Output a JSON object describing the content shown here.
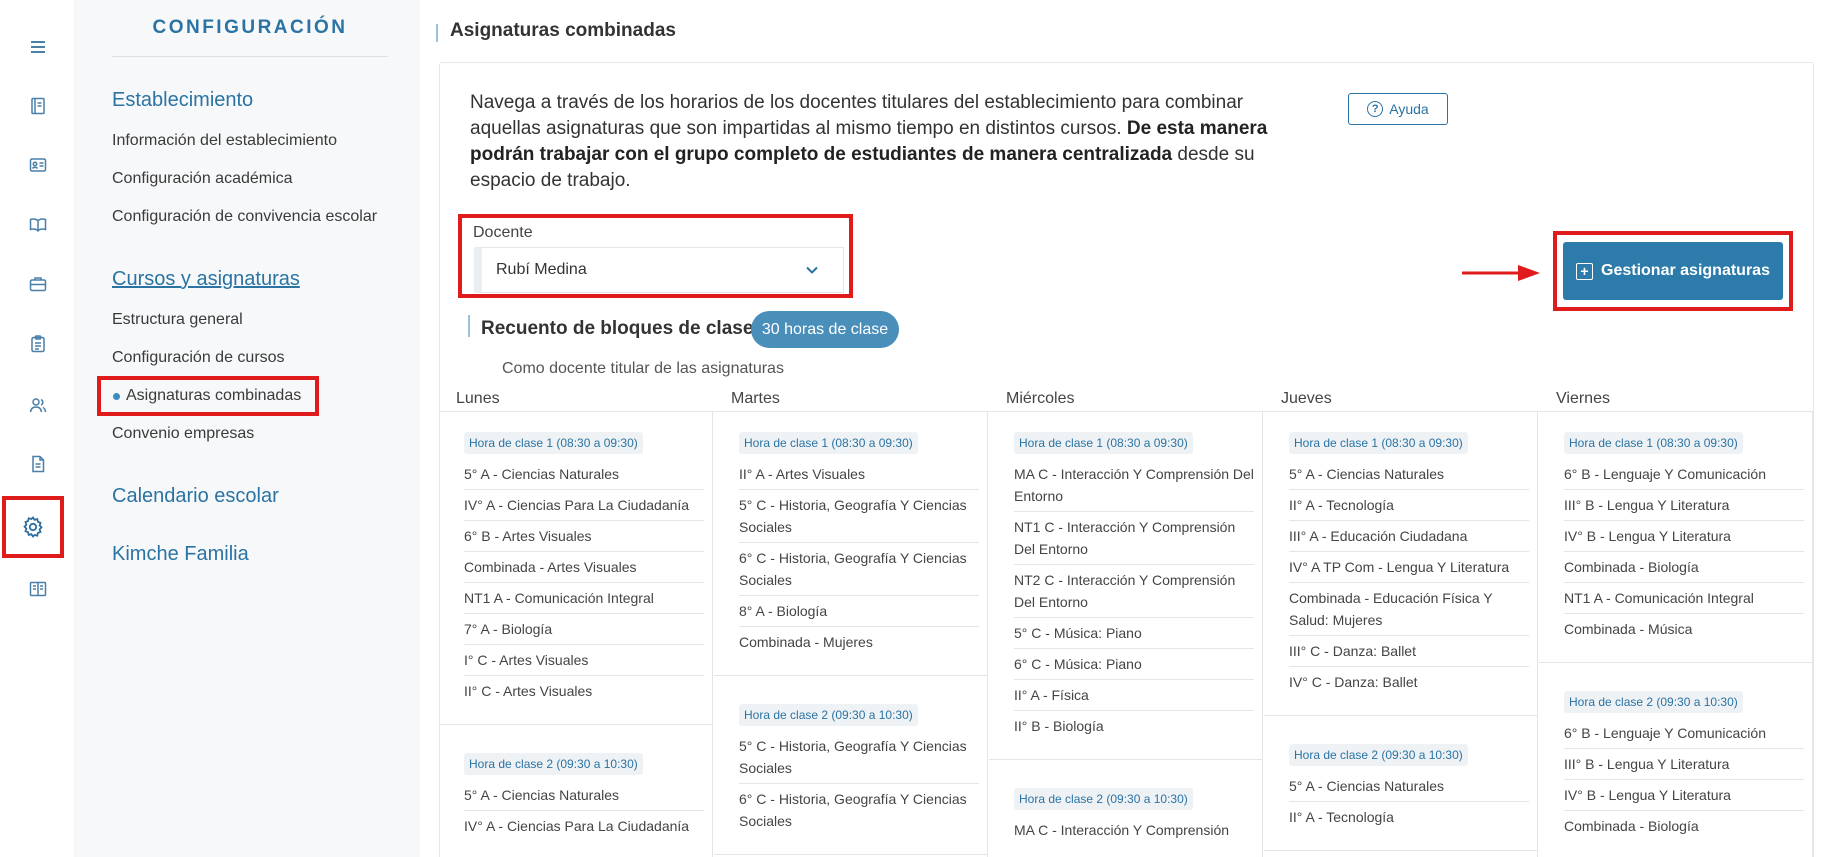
{
  "rail": {
    "icons": [
      "menu-icon",
      "book-icon",
      "id-card-icon",
      "open-book-icon",
      "briefcase-icon",
      "clipboard-icon",
      "users-icon",
      "document-icon",
      "gear-icon",
      "reading-icon"
    ]
  },
  "sidebar": {
    "title": "CONFIGURACIÓN",
    "sections": {
      "establecimiento": "Establecimiento",
      "cursos": "Cursos y asignaturas",
      "calendario": "Calendario escolar",
      "familia": "Kimche Familia"
    },
    "items": {
      "info": "Información del establecimiento",
      "academica": "Configuración académica",
      "convivencia": "Configuración de convivencia escolar",
      "estructura": "Estructura general",
      "cursos_config": "Configuración de cursos",
      "combinadas": "Asignaturas combinadas",
      "convenio": "Convenio empresas"
    }
  },
  "main": {
    "title": "Asignaturas combinadas",
    "intro_1": "Navega a través de los horarios de los docentes titulares del establecimiento para combinar aquellas asignaturas que son impartidas al mismo tiempo en distintos cursos. ",
    "intro_bold": "De esta manera podrán trabajar con el grupo completo de estudiantes de manera centralizada",
    "intro_2": " desde su espacio de trabajo.",
    "help_label": "Ayuda",
    "docente_label": "Docente",
    "docente_value": "Rubí Medina",
    "manage_label": "Gestionar asignaturas",
    "count_label": "Recuento de bloques de clase:",
    "count_value": "30 horas de clase",
    "count_note": "Como docente titular de las asignaturas"
  },
  "schedule": {
    "days": [
      "Lunes",
      "Martes",
      "Miércoles",
      "Jueves",
      "Viernes"
    ],
    "columns": [
      [
        {
          "hour": "Hora de clase 1 (08:30 a 09:30)",
          "subjects": [
            "5° A - Ciencias Naturales",
            "IV° A - Ciencias Para La Ciudadanía",
            "6° B - Artes Visuales",
            "Combinada - Artes Visuales",
            "NT1 A - Comunicación Integral",
            "7° A - Biología",
            "I° C - Artes Visuales",
            "II° C - Artes Visuales"
          ]
        },
        {
          "hour": "Hora de clase 2 (09:30 a 10:30)",
          "subjects": [
            "5° A - Ciencias Naturales",
            "IV° A - Ciencias Para La Ciudadanía"
          ]
        }
      ],
      [
        {
          "hour": "Hora de clase 1 (08:30 a 09:30)",
          "subjects": [
            "II° A - Artes Visuales",
            "5° C - Historia, Geografía Y Ciencias Sociales",
            "6° C - Historia, Geografía Y Ciencias Sociales",
            "8° A - Biología",
            "Combinada - Mujeres"
          ]
        },
        {
          "hour": "Hora de clase 2 (09:30 a 10:30)",
          "subjects": [
            "5° C - Historia, Geografía Y Ciencias Sociales",
            "6° C - Historia, Geografía Y Ciencias Sociales"
          ]
        }
      ],
      [
        {
          "hour": "Hora de clase 1 (08:30 a 09:30)",
          "subjects": [
            "MA C - Interacción Y Comprensión Del Entorno",
            "NT1 C - Interacción Y Comprensión Del Entorno",
            "NT2 C - Interacción Y Comprensión Del Entorno",
            "5° C - Música: Piano",
            "6° C - Música: Piano",
            "II° A - Física",
            "II° B - Biología"
          ]
        },
        {
          "hour": "Hora de clase 2 (09:30 a 10:30)",
          "subjects": [
            "MA C - Interacción Y Comprensión"
          ]
        }
      ],
      [
        {
          "hour": "Hora de clase 1 (08:30 a 09:30)",
          "subjects": [
            "5° A - Ciencias Naturales",
            "II° A - Tecnología",
            "III° A - Educación Ciudadana",
            "IV° A TP Com - Lengua Y Literatura",
            "Combinada - Educación Física Y Salud: Mujeres",
            "III° C - Danza: Ballet",
            "IV° C - Danza: Ballet"
          ]
        },
        {
          "hour": "Hora de clase 2 (09:30 a 10:30)",
          "subjects": [
            "5° A - Ciencias Naturales",
            "II° A - Tecnología"
          ]
        }
      ],
      [
        {
          "hour": "Hora de clase 1 (08:30 a 09:30)",
          "subjects": [
            "6° B - Lenguaje Y Comunicación",
            "III° B - Lengua Y Literatura",
            "IV° B - Lengua Y Literatura",
            "Combinada - Biología",
            "NT1 A - Comunicación Integral",
            "Combinada - Música"
          ]
        },
        {
          "hour": "Hora de clase 2 (09:30 a 10:30)",
          "subjects": [
            "6° B - Lenguaje Y Comunicación",
            "III° B - Lengua Y Literatura",
            "IV° B - Lengua Y Literatura",
            "Combinada - Biología"
          ]
        }
      ]
    ]
  }
}
